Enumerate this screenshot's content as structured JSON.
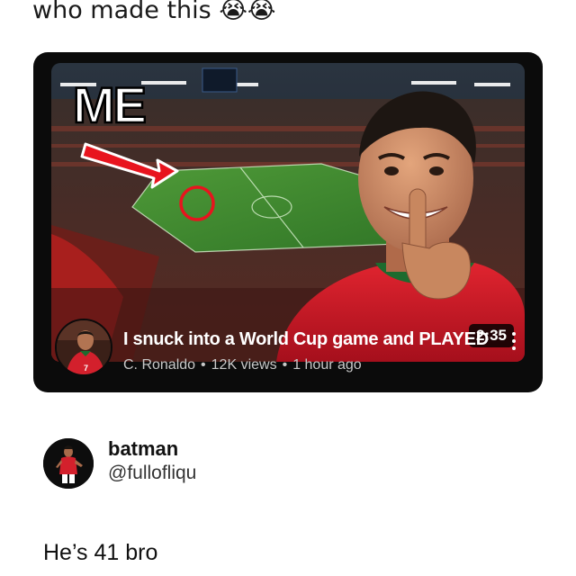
{
  "post": {
    "caption": "who made this 😭😭"
  },
  "video": {
    "overlay_text": "ME",
    "duration": "2:35",
    "title": "I snuck into a World Cup game and PLAYED",
    "channel": "C. Ronaldo",
    "views": "12K views",
    "age": "1 hour ago",
    "separator": "•",
    "jersey_number": "7"
  },
  "reply": {
    "display_name": "batman",
    "handle": "@fullofliqu",
    "text": "He’s 41 bro"
  },
  "colors": {
    "card_bg": "#0b0b0b",
    "arrow_red": "#e8141e",
    "pitch_green": "#3d8a2e",
    "jersey_red": "#c8102e"
  }
}
